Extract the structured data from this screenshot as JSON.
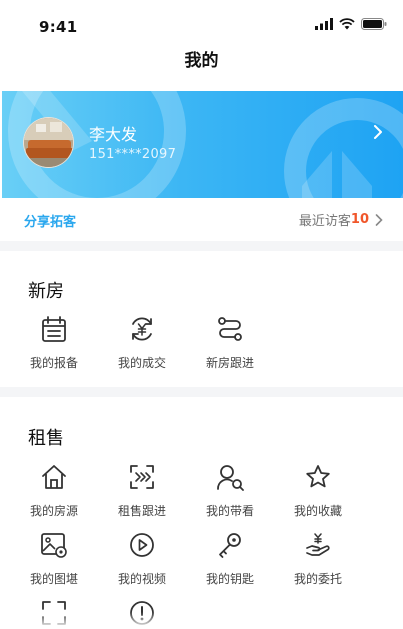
{
  "status_bar": {
    "time": "9:41"
  },
  "nav": {
    "title": "我的"
  },
  "profile": {
    "name": "李大发",
    "phone": "151****2097"
  },
  "share": {
    "label": "分享拓客",
    "visitors_label": "最近访客",
    "visitors_count": "10"
  },
  "sections": {
    "new_house": {
      "title": "新房",
      "items": [
        {
          "label": "我的报备",
          "icon": "calendar-icon"
        },
        {
          "label": "我的成交",
          "icon": "yuan-cycle-icon"
        },
        {
          "label": "新房跟进",
          "icon": "route-icon"
        }
      ]
    },
    "rent_sale": {
      "title": "租售",
      "items": [
        {
          "label": "我的房源",
          "icon": "house-icon"
        },
        {
          "label": "租售跟进",
          "icon": "scan-forward-icon"
        },
        {
          "label": "我的带看",
          "icon": "user-view-icon"
        },
        {
          "label": "我的收藏",
          "icon": "star-icon"
        },
        {
          "label": "我的图堪",
          "icon": "image-settings-icon"
        },
        {
          "label": "我的视频",
          "icon": "play-icon"
        },
        {
          "label": "我的钥匙",
          "icon": "key-icon"
        },
        {
          "label": "我的委托",
          "icon": "hand-money-icon"
        }
      ]
    }
  },
  "colors": {
    "accent": "#2aa7ee",
    "highlight": "#f0562a",
    "banner_start": "#69cff6",
    "banner_end": "#1ea3f3"
  }
}
